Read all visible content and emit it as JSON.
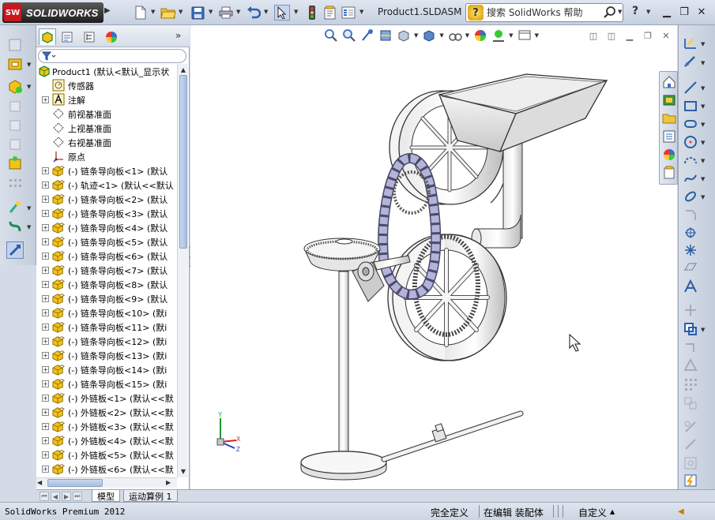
{
  "app": {
    "logo_badge": "SW",
    "logo_text": "SOLIDWORKS",
    "document_title": "Product1.SLDASM *",
    "search_placeholder": "搜索 SolidWorks 帮助",
    "help_label": "?"
  },
  "colors": {
    "accent": "#3a6fbf",
    "toolbar_bg": "#d4dbe6",
    "assembly_yellow": "#f2c21a",
    "chain_purple": "#b4b4da"
  },
  "icons": {
    "new": "new-document-icon",
    "open": "open-folder-icon",
    "save": "save-icon",
    "print": "print-icon",
    "undo": "undo-icon",
    "select": "select-arrow-icon",
    "rebuild": "traffic-light-icon",
    "options": "options-icon"
  },
  "feature_manager": {
    "tabs": [
      "feature-manager-tab",
      "property-manager-tab",
      "configuration-manager-tab",
      "display-manager-tab"
    ],
    "tree": [
      {
        "label": "Product1  (默认<默认_显示状",
        "indent": 0,
        "expander": "",
        "icon": "assembly"
      },
      {
        "label": "传感器",
        "indent": 1,
        "expander": "",
        "icon": "sensor"
      },
      {
        "label": "注解",
        "indent": 1,
        "expander": "+",
        "icon": "annotation"
      },
      {
        "label": "前视基准面",
        "indent": 1,
        "expander": "",
        "icon": "plane"
      },
      {
        "label": "上视基准面",
        "indent": 1,
        "expander": "",
        "icon": "plane"
      },
      {
        "label": "右视基准面",
        "indent": 1,
        "expander": "",
        "icon": "plane"
      },
      {
        "label": "原点",
        "indent": 1,
        "expander": "",
        "icon": "origin"
      },
      {
        "label": "(-) 链条导向板<1> (默认",
        "indent": 1,
        "expander": "+",
        "icon": "part"
      },
      {
        "label": "(-) 轨迹<1> (默认<<默认",
        "indent": 1,
        "expander": "+",
        "icon": "part"
      },
      {
        "label": "(-) 链条导向板<2> (默认",
        "indent": 1,
        "expander": "+",
        "icon": "part"
      },
      {
        "label": "(-) 链条导向板<3> (默认",
        "indent": 1,
        "expander": "+",
        "icon": "part"
      },
      {
        "label": "(-) 链条导向板<4> (默认",
        "indent": 1,
        "expander": "+",
        "icon": "part"
      },
      {
        "label": "(-) 链条导向板<5> (默认",
        "indent": 1,
        "expander": "+",
        "icon": "part"
      },
      {
        "label": "(-) 链条导向板<6> (默认",
        "indent": 1,
        "expander": "+",
        "icon": "part"
      },
      {
        "label": "(-) 链条导向板<7> (默认",
        "indent": 1,
        "expander": "+",
        "icon": "part"
      },
      {
        "label": "(-) 链条导向板<8> (默认",
        "indent": 1,
        "expander": "+",
        "icon": "part"
      },
      {
        "label": "(-) 链条导向板<9> (默认",
        "indent": 1,
        "expander": "+",
        "icon": "part"
      },
      {
        "label": "(-) 链条导向板<10> (默i",
        "indent": 1,
        "expander": "+",
        "icon": "part"
      },
      {
        "label": "(-) 链条导向板<11> (默i",
        "indent": 1,
        "expander": "+",
        "icon": "part"
      },
      {
        "label": "(-) 链条导向板<12> (默i",
        "indent": 1,
        "expander": "+",
        "icon": "part"
      },
      {
        "label": "(-) 链条导向板<13> (默i",
        "indent": 1,
        "expander": "+",
        "icon": "part"
      },
      {
        "label": "(-) 链条导向板<14> (默i",
        "indent": 1,
        "expander": "+",
        "icon": "part"
      },
      {
        "label": "(-) 链条导向板<15> (默i",
        "indent": 1,
        "expander": "+",
        "icon": "part"
      },
      {
        "label": "(-) 外链板<1> (默认<<默",
        "indent": 1,
        "expander": "+",
        "icon": "part"
      },
      {
        "label": "(-) 外链板<2> (默认<<默",
        "indent": 1,
        "expander": "+",
        "icon": "part"
      },
      {
        "label": "(-) 外链板<3> (默认<<默",
        "indent": 1,
        "expander": "+",
        "icon": "part"
      },
      {
        "label": "(-) 外链板<4> (默认<<默",
        "indent": 1,
        "expander": "+",
        "icon": "part"
      },
      {
        "label": "(-) 外链板<5> (默认<<默",
        "indent": 1,
        "expander": "+",
        "icon": "part"
      },
      {
        "label": "(-) 外链板<6> (默认<<默",
        "indent": 1,
        "expander": "+",
        "icon": "part"
      }
    ]
  },
  "bottom_tabs": [
    "模型",
    "运动算例 1"
  ],
  "status": {
    "app_version": "SolidWorks Premium 2012",
    "fully_defined": "完全定义",
    "editing": "在编辑 装配体",
    "units": "自定义"
  },
  "triad": {
    "x": "X",
    "y": "Y",
    "z": "Z"
  }
}
